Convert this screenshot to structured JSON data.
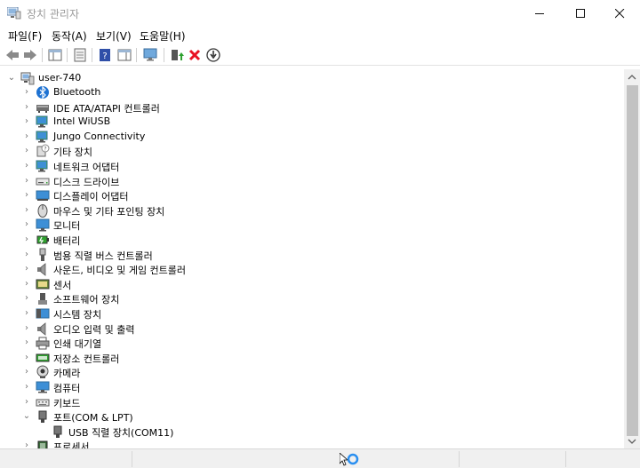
{
  "window": {
    "title": "장치 관리자"
  },
  "menu": [
    "파일(F)",
    "동작(A)",
    "보기(V)",
    "도움말(H)"
  ],
  "toolbar_icons": [
    "back-icon",
    "forward-icon",
    "properties-view-icon",
    "list-view-icon",
    "help-icon",
    "action-pane-icon",
    "monitor-scan-icon",
    "update-driver-icon",
    "uninstall-icon",
    "disable-device-icon"
  ],
  "tree": {
    "root": "user-740",
    "categories": [
      {
        "label": "Bluetooth",
        "icon": "bluetooth-icon"
      },
      {
        "label": "IDE ATA/ATAPI 컨트롤러",
        "icon": "ide-controller-icon"
      },
      {
        "label": "Intel WiUSB",
        "icon": "network-monitor-icon"
      },
      {
        "label": "Jungo Connectivity",
        "icon": "network-monitor-icon"
      },
      {
        "label": "기타 장치",
        "icon": "unknown-device-icon"
      },
      {
        "label": "네트워크 어댑터",
        "icon": "network-adapter-icon"
      },
      {
        "label": "디스크 드라이브",
        "icon": "disk-drive-icon"
      },
      {
        "label": "디스플레이 어댑터",
        "icon": "display-adapter-icon"
      },
      {
        "label": "마우스 및 기타 포인팅 장치",
        "icon": "mouse-icon"
      },
      {
        "label": "모니터",
        "icon": "monitor-icon"
      },
      {
        "label": "배터리",
        "icon": "battery-icon"
      },
      {
        "label": "범용 직렬 버스 컨트롤러",
        "icon": "usb-icon"
      },
      {
        "label": "사운드, 비디오 및 게임 컨트롤러",
        "icon": "speaker-icon"
      },
      {
        "label": "센서",
        "icon": "sensor-icon"
      },
      {
        "label": "소프트웨어 장치",
        "icon": "software-device-icon"
      },
      {
        "label": "시스템 장치",
        "icon": "system-device-icon"
      },
      {
        "label": "오디오 입력 및 출력",
        "icon": "speaker-icon"
      },
      {
        "label": "인쇄 대기열",
        "icon": "printer-icon"
      },
      {
        "label": "저장소 컨트롤러",
        "icon": "storage-controller-icon"
      },
      {
        "label": "카메라",
        "icon": "camera-icon"
      },
      {
        "label": "컴퓨터",
        "icon": "computer-icon"
      },
      {
        "label": "키보드",
        "icon": "keyboard-icon"
      },
      {
        "label": "포트(COM & LPT)",
        "icon": "port-icon",
        "expanded": true,
        "children": [
          {
            "label": "USB 직렬 장치(COM11)",
            "icon": "port-icon"
          }
        ]
      },
      {
        "label": "프로세서",
        "icon": "processor-icon"
      }
    ]
  },
  "colors": {
    "title_text": "#9a9a9a",
    "close_red": "#e81123",
    "update_green": "#2fa12f",
    "bluetooth_blue": "#1e72d2"
  }
}
